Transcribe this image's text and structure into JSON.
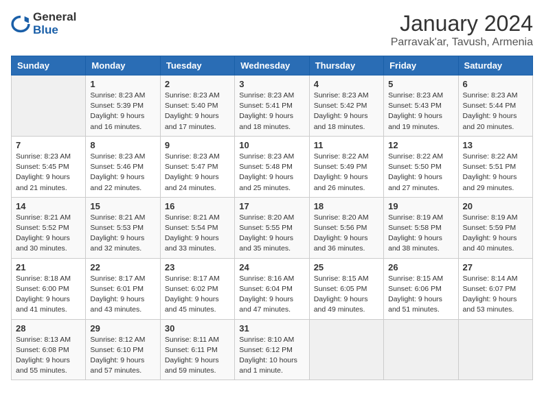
{
  "logo": {
    "line1": "General",
    "line2": "Blue"
  },
  "title": "January 2024",
  "location": "Parravak'ar, Tavush, Armenia",
  "days_of_week": [
    "Sunday",
    "Monday",
    "Tuesday",
    "Wednesday",
    "Thursday",
    "Friday",
    "Saturday"
  ],
  "weeks": [
    [
      {
        "day": "",
        "sunrise": "",
        "sunset": "",
        "daylight": ""
      },
      {
        "day": "1",
        "sunrise": "Sunrise: 8:23 AM",
        "sunset": "Sunset: 5:39 PM",
        "daylight": "Daylight: 9 hours and 16 minutes."
      },
      {
        "day": "2",
        "sunrise": "Sunrise: 8:23 AM",
        "sunset": "Sunset: 5:40 PM",
        "daylight": "Daylight: 9 hours and 17 minutes."
      },
      {
        "day": "3",
        "sunrise": "Sunrise: 8:23 AM",
        "sunset": "Sunset: 5:41 PM",
        "daylight": "Daylight: 9 hours and 18 minutes."
      },
      {
        "day": "4",
        "sunrise": "Sunrise: 8:23 AM",
        "sunset": "Sunset: 5:42 PM",
        "daylight": "Daylight: 9 hours and 18 minutes."
      },
      {
        "day": "5",
        "sunrise": "Sunrise: 8:23 AM",
        "sunset": "Sunset: 5:43 PM",
        "daylight": "Daylight: 9 hours and 19 minutes."
      },
      {
        "day": "6",
        "sunrise": "Sunrise: 8:23 AM",
        "sunset": "Sunset: 5:44 PM",
        "daylight": "Daylight: 9 hours and 20 minutes."
      }
    ],
    [
      {
        "day": "7",
        "sunrise": "Sunrise: 8:23 AM",
        "sunset": "Sunset: 5:45 PM",
        "daylight": "Daylight: 9 hours and 21 minutes."
      },
      {
        "day": "8",
        "sunrise": "Sunrise: 8:23 AM",
        "sunset": "Sunset: 5:46 PM",
        "daylight": "Daylight: 9 hours and 22 minutes."
      },
      {
        "day": "9",
        "sunrise": "Sunrise: 8:23 AM",
        "sunset": "Sunset: 5:47 PM",
        "daylight": "Daylight: 9 hours and 24 minutes."
      },
      {
        "day": "10",
        "sunrise": "Sunrise: 8:23 AM",
        "sunset": "Sunset: 5:48 PM",
        "daylight": "Daylight: 9 hours and 25 minutes."
      },
      {
        "day": "11",
        "sunrise": "Sunrise: 8:22 AM",
        "sunset": "Sunset: 5:49 PM",
        "daylight": "Daylight: 9 hours and 26 minutes."
      },
      {
        "day": "12",
        "sunrise": "Sunrise: 8:22 AM",
        "sunset": "Sunset: 5:50 PM",
        "daylight": "Daylight: 9 hours and 27 minutes."
      },
      {
        "day": "13",
        "sunrise": "Sunrise: 8:22 AM",
        "sunset": "Sunset: 5:51 PM",
        "daylight": "Daylight: 9 hours and 29 minutes."
      }
    ],
    [
      {
        "day": "14",
        "sunrise": "Sunrise: 8:21 AM",
        "sunset": "Sunset: 5:52 PM",
        "daylight": "Daylight: 9 hours and 30 minutes."
      },
      {
        "day": "15",
        "sunrise": "Sunrise: 8:21 AM",
        "sunset": "Sunset: 5:53 PM",
        "daylight": "Daylight: 9 hours and 32 minutes."
      },
      {
        "day": "16",
        "sunrise": "Sunrise: 8:21 AM",
        "sunset": "Sunset: 5:54 PM",
        "daylight": "Daylight: 9 hours and 33 minutes."
      },
      {
        "day": "17",
        "sunrise": "Sunrise: 8:20 AM",
        "sunset": "Sunset: 5:55 PM",
        "daylight": "Daylight: 9 hours and 35 minutes."
      },
      {
        "day": "18",
        "sunrise": "Sunrise: 8:20 AM",
        "sunset": "Sunset: 5:56 PM",
        "daylight": "Daylight: 9 hours and 36 minutes."
      },
      {
        "day": "19",
        "sunrise": "Sunrise: 8:19 AM",
        "sunset": "Sunset: 5:58 PM",
        "daylight": "Daylight: 9 hours and 38 minutes."
      },
      {
        "day": "20",
        "sunrise": "Sunrise: 8:19 AM",
        "sunset": "Sunset: 5:59 PM",
        "daylight": "Daylight: 9 hours and 40 minutes."
      }
    ],
    [
      {
        "day": "21",
        "sunrise": "Sunrise: 8:18 AM",
        "sunset": "Sunset: 6:00 PM",
        "daylight": "Daylight: 9 hours and 41 minutes."
      },
      {
        "day": "22",
        "sunrise": "Sunrise: 8:17 AM",
        "sunset": "Sunset: 6:01 PM",
        "daylight": "Daylight: 9 hours and 43 minutes."
      },
      {
        "day": "23",
        "sunrise": "Sunrise: 8:17 AM",
        "sunset": "Sunset: 6:02 PM",
        "daylight": "Daylight: 9 hours and 45 minutes."
      },
      {
        "day": "24",
        "sunrise": "Sunrise: 8:16 AM",
        "sunset": "Sunset: 6:04 PM",
        "daylight": "Daylight: 9 hours and 47 minutes."
      },
      {
        "day": "25",
        "sunrise": "Sunrise: 8:15 AM",
        "sunset": "Sunset: 6:05 PM",
        "daylight": "Daylight: 9 hours and 49 minutes."
      },
      {
        "day": "26",
        "sunrise": "Sunrise: 8:15 AM",
        "sunset": "Sunset: 6:06 PM",
        "daylight": "Daylight: 9 hours and 51 minutes."
      },
      {
        "day": "27",
        "sunrise": "Sunrise: 8:14 AM",
        "sunset": "Sunset: 6:07 PM",
        "daylight": "Daylight: 9 hours and 53 minutes."
      }
    ],
    [
      {
        "day": "28",
        "sunrise": "Sunrise: 8:13 AM",
        "sunset": "Sunset: 6:08 PM",
        "daylight": "Daylight: 9 hours and 55 minutes."
      },
      {
        "day": "29",
        "sunrise": "Sunrise: 8:12 AM",
        "sunset": "Sunset: 6:10 PM",
        "daylight": "Daylight: 9 hours and 57 minutes."
      },
      {
        "day": "30",
        "sunrise": "Sunrise: 8:11 AM",
        "sunset": "Sunset: 6:11 PM",
        "daylight": "Daylight: 9 hours and 59 minutes."
      },
      {
        "day": "31",
        "sunrise": "Sunrise: 8:10 AM",
        "sunset": "Sunset: 6:12 PM",
        "daylight": "Daylight: 10 hours and 1 minute."
      },
      {
        "day": "",
        "sunrise": "",
        "sunset": "",
        "daylight": ""
      },
      {
        "day": "",
        "sunrise": "",
        "sunset": "",
        "daylight": ""
      },
      {
        "day": "",
        "sunrise": "",
        "sunset": "",
        "daylight": ""
      }
    ]
  ]
}
